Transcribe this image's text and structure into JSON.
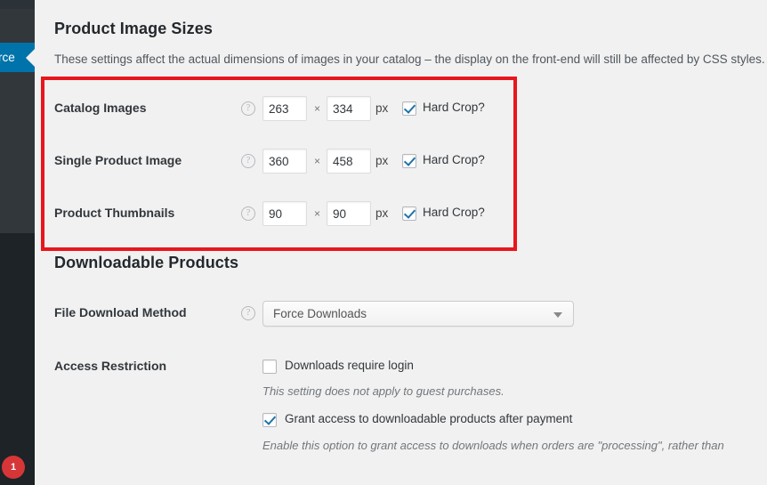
{
  "sidebar": {
    "current_menu_label": "rce",
    "notification_badge": "1",
    "accent_color": "#0073aa",
    "background_color": "#32373c"
  },
  "annotation": {
    "color": "#e8161d"
  },
  "sections": {
    "image_sizes": {
      "title": "Product Image Sizes",
      "description": "These settings affect the actual dimensions of images in your catalog – the display on the front-end will still be affected by CSS styles. Aft",
      "unit": "px",
      "times_symbol": "×",
      "hard_crop_label": "Hard Crop?",
      "rows": [
        {
          "label": "Catalog Images",
          "width": "263",
          "height": "334",
          "hard_crop": true
        },
        {
          "label": "Single Product Image",
          "width": "360",
          "height": "458",
          "hard_crop": true
        },
        {
          "label": "Product Thumbnails",
          "width": "90",
          "height": "90",
          "hard_crop": true
        }
      ]
    },
    "downloadable": {
      "title": "Downloadable Products",
      "file_download_method": {
        "label": "File Download Method",
        "selected": "Force Downloads"
      },
      "access_restriction": {
        "label": "Access Restriction",
        "require_login": {
          "text": "Downloads require login",
          "checked": false,
          "description": "This setting does not apply to guest purchases."
        },
        "grant_access": {
          "text": "Grant access to downloadable products after payment",
          "checked": true,
          "description": "Enable this option to grant access to downloads when orders are \"processing\", rather than"
        }
      }
    }
  }
}
